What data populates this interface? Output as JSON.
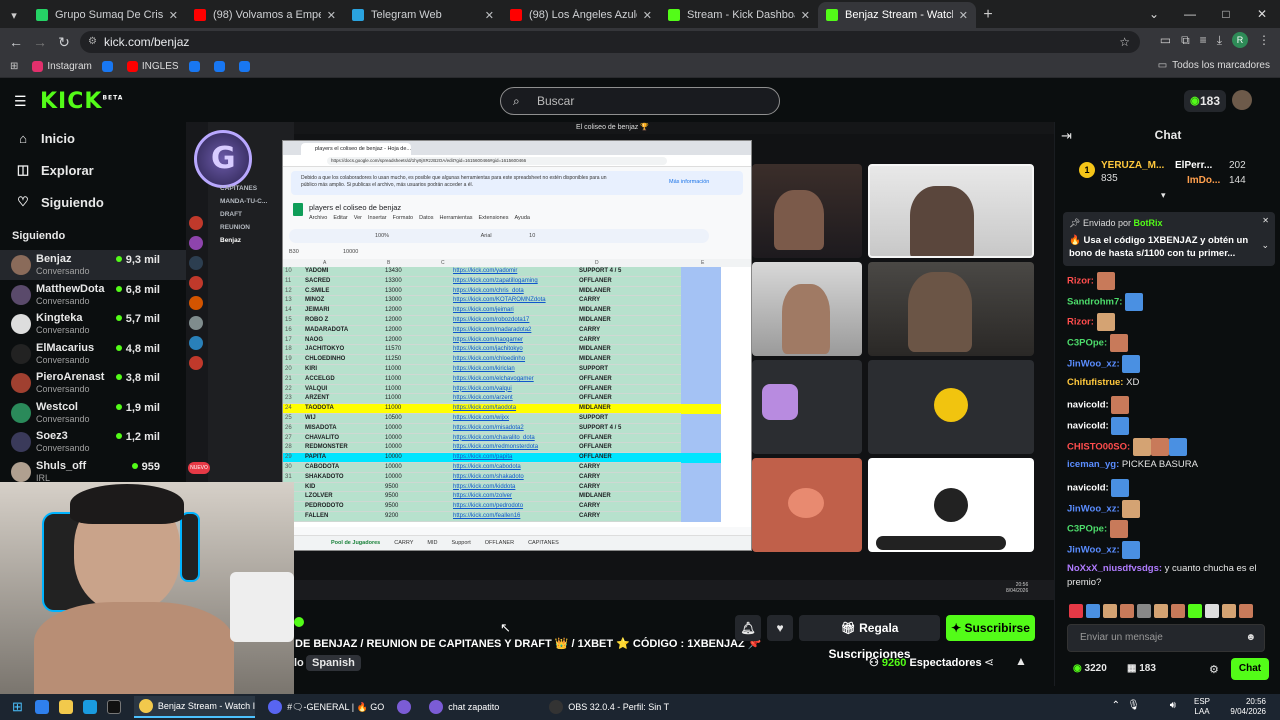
{
  "browser": {
    "tabs": [
      {
        "label": "Grupo Sumaq De Crispin Alegría",
        "color": "#25d366",
        "active": false
      },
      {
        "label": "(98) Volvamos a Empezar - YouTube",
        "color": "#ff0000",
        "active": false
      },
      {
        "label": "Telegram Web",
        "color": "#2aa3df",
        "active": false
      },
      {
        "label": "(98) Los Ángeles Azules - Nunca...",
        "color": "#ff0000",
        "active": false
      },
      {
        "label": "Stream - Kick Dashboard",
        "color": "#53fc18",
        "active": false
      },
      {
        "label": "Benjaz Stream - Watch Live",
        "color": "#53fc18",
        "active": true
      }
    ],
    "url": "kick.com/benjaz",
    "bookmarks": [
      {
        "label": "Instagram",
        "color": "#e1306c"
      },
      {
        "label": "",
        "color": "#1877f2"
      },
      {
        "label": "INGLES",
        "color": "#ff0000"
      },
      {
        "label": "",
        "color": "#1877f2"
      },
      {
        "label": "",
        "color": "#1877f2"
      },
      {
        "label": "",
        "color": "#1877f2"
      }
    ],
    "all_bookmarks": "Todos los marcadores",
    "profile_initial": "R"
  },
  "kick": {
    "logo": "KICK",
    "logo_sup": "BETA",
    "search_placeholder": "Buscar",
    "points": "183",
    "nav": [
      {
        "label": "Inicio",
        "icon": "home-icon",
        "glyph": "⌂"
      },
      {
        "label": "Explorar",
        "icon": "compass-icon",
        "glyph": "◫"
      },
      {
        "label": "Siguiendo",
        "icon": "heart-icon",
        "glyph": "♡"
      }
    ],
    "following_header": "Siguiendo",
    "following": [
      {
        "name": "Benjaz",
        "category": "Conversando",
        "viewers": "9,3 mil",
        "active": true,
        "avatar": "#8a6b5a"
      },
      {
        "name": "MatthewDota",
        "category": "Conversando",
        "viewers": "6,8 mil",
        "active": false,
        "avatar": "#5a4a6b"
      },
      {
        "name": "Kingteka",
        "category": "Conversando",
        "viewers": "5,7 mil",
        "active": false,
        "avatar": "#dddddd"
      },
      {
        "name": "ElMacarius",
        "category": "Conversando",
        "viewers": "4,8 mil",
        "active": false,
        "avatar": "#222222"
      },
      {
        "name": "PieroArenast",
        "category": "Conversando",
        "viewers": "3,8 mil",
        "active": false,
        "avatar": "#a04030"
      },
      {
        "name": "Westcol",
        "category": "Conversando",
        "viewers": "1,9 mil",
        "active": false,
        "avatar": "#2a8a5a"
      },
      {
        "name": "Soez3",
        "category": "Conversando",
        "viewers": "1,2 mil",
        "active": false,
        "avatar": "#3a3a5a"
      },
      {
        "name": "Shuls_off",
        "category": "IRL",
        "viewers": "959",
        "active": false,
        "avatar": "#b0a090"
      }
    ]
  },
  "stream": {
    "inner_title": "El coliseo de benjaz 🏆",
    "sheet": {
      "tab_title": "players el coliseo de benjaz - Hoja de...",
      "url": "https://docs.google.com/spreadsheets/d/1hy9jXRzzB2OA/edit?gid=1615600466#gid=1615600466",
      "banner": "Debido a que los colaboradores lo usan mucho, es posible que algunas herramientas para este spreadsheet no estén disponibles para un público más amplio. Si publicas el archivo, más usuarios podrán acceder a él.",
      "banner_link": "Más información",
      "doc_title": "players el coliseo de benjaz",
      "menus": [
        "Archivo",
        "Editar",
        "Ver",
        "Insertar",
        "Formato",
        "Datos",
        "Herramientas",
        "Extensiones",
        "Ayuda"
      ],
      "cell_ref": "B30",
      "formula": "10000",
      "zoom": "100%",
      "font": "Arial",
      "font_size": "10",
      "columns": [
        "A",
        "B",
        "C",
        "D",
        "E"
      ],
      "rows": [
        {
          "n": "10",
          "name": "YADOMI",
          "mmr": "13430",
          "link": "https://kick.com/yadomir",
          "role": "SUPPORT 4 / 5",
          "hl": ""
        },
        {
          "n": "11",
          "name": "SACRED",
          "mmr": "13300",
          "link": "https://kick.com/zapatillogaming",
          "role": "OFFLANER",
          "hl": ""
        },
        {
          "n": "12",
          "name": "C.SMILE",
          "mmr": "13000",
          "link": "https://kick.com/chris_dota",
          "role": "MIDLANER",
          "hl": ""
        },
        {
          "n": "13",
          "name": "MINOZ",
          "mmr": "13000",
          "link": "https://kick.com/KOTAROMNZdota",
          "role": "CARRY",
          "hl": ""
        },
        {
          "n": "14",
          "name": "JEIMARI",
          "mmr": "12000",
          "link": "https://kick.com/jeimari",
          "role": "MIDLANER",
          "hl": ""
        },
        {
          "n": "15",
          "name": "ROBO Z",
          "mmr": "12000",
          "link": "https://kick.com/robozdota17",
          "role": "MIDLANER",
          "hl": ""
        },
        {
          "n": "16",
          "name": "MADARADOTA",
          "mmr": "12000",
          "link": "https://kick.com/madaradota2",
          "role": "CARRY",
          "hl": ""
        },
        {
          "n": "17",
          "name": "NAOG",
          "mmr": "12000",
          "link": "https://kick.com/naogamer",
          "role": "CARRY",
          "hl": ""
        },
        {
          "n": "18",
          "name": "JACHITOKYO",
          "mmr": "11570",
          "link": "https://kick.com/jachitokyo",
          "role": "MIDLANER",
          "hl": ""
        },
        {
          "n": "19",
          "name": "CHLOEDINHO",
          "mmr": "11250",
          "link": "https://kick.com/chloedinho",
          "role": "MIDLANER",
          "hl": ""
        },
        {
          "n": "20",
          "name": "KIRI",
          "mmr": "11000",
          "link": "https://kick.com/kiriclan",
          "role": "SUPPORT",
          "hl": ""
        },
        {
          "n": "21",
          "name": "ACCELGD",
          "mmr": "11000",
          "link": "https://kick.com/elchavogamer",
          "role": "OFFLANER",
          "hl": ""
        },
        {
          "n": "22",
          "name": "VALQUI",
          "mmr": "11000",
          "link": "https://kick.com/valqui",
          "role": "OFFLANER",
          "hl": ""
        },
        {
          "n": "23",
          "name": "ARZENT",
          "mmr": "11000",
          "link": "https://kick.com/arzent",
          "role": "OFFLANER",
          "hl": ""
        },
        {
          "n": "24",
          "name": "TAODOTA",
          "mmr": "11000",
          "link": "https://kick.com/taodota",
          "role": "MIDLANER",
          "hl": "#ffff00"
        },
        {
          "n": "25",
          "name": "WIJ",
          "mmr": "10500",
          "link": "https://kick.com/wijxx",
          "role": "SUPPORT",
          "hl": ""
        },
        {
          "n": "26",
          "name": "MISADOTA",
          "mmr": "10000",
          "link": "https://kick.com/misadota2",
          "role": "SUPPORT 4 / 5",
          "hl": ""
        },
        {
          "n": "27",
          "name": "CHAVALITO",
          "mmr": "10000",
          "link": "https://kick.com/chavalito_dota",
          "role": "OFFLANER",
          "hl": ""
        },
        {
          "n": "28",
          "name": "REDMONSTER",
          "mmr": "10000",
          "link": "https://kick.com/redmonsterdota",
          "role": "OFFLANER",
          "hl": ""
        },
        {
          "n": "29",
          "name": "PAPITA",
          "mmr": "10000",
          "link": "https://kick.com/papita",
          "role": "OFFLANER",
          "hl": "#00e5ff"
        },
        {
          "n": "30",
          "name": "CABODOTA",
          "mmr": "10000",
          "link": "https://kick.com/cabodota",
          "role": "CARRY",
          "hl": ""
        },
        {
          "n": "31",
          "name": "SHAKADOTO",
          "mmr": "10000",
          "link": "https://kick.com/shakadoto",
          "role": "CARRY",
          "hl": ""
        },
        {
          "n": "32",
          "name": "KID",
          "mmr": "9500",
          "link": "https://kick.com/kiddota",
          "role": "CARRY",
          "hl": ""
        },
        {
          "n": "33",
          "name": "LZOLVER",
          "mmr": "9500",
          "link": "https://kick.com/zolver",
          "role": "MIDLANER",
          "hl": ""
        },
        {
          "n": "34",
          "name": "PEDRODOTO",
          "mmr": "9500",
          "link": "https://kick.com/pedrodoto",
          "role": "CARRY",
          "hl": ""
        },
        {
          "n": "35",
          "name": "FALLEN",
          "mmr": "9200",
          "link": "https://kick.com/feallen16",
          "role": "CARRY",
          "hl": ""
        }
      ],
      "sheet_tabs": [
        "Pool de Jugadores",
        "CARRY",
        "MID",
        "Support",
        "OFFLANER",
        "CAPITANES"
      ]
    },
    "discord_channels": [
      "CAPITANES",
      "MANDA-TU-C...",
      "DRAFT",
      "REUNION",
      "Benjaz"
    ],
    "clock": "20:56",
    "date": "8/04/2026",
    "title": "DE BENJAZ / REUNION DE CAPITANES Y DRAFT 👑 / 1XBET ⭐ CÓDIGO : 1XBENJAZ 📌",
    "title_prefix": "lo",
    "language": "Spanish",
    "gift_button": "Regala Suscripciones",
    "subscribe_button": "Suscribirse",
    "viewers": "9260",
    "viewers_label": "Espectadores"
  },
  "chat": {
    "title": "Chat",
    "leaders": [
      {
        "name": "YERUZA_M...",
        "value": "835",
        "rank": "1"
      },
      {
        "name": "ElPerr...",
        "value": "202"
      },
      {
        "name": "ImDo...",
        "value": "144"
      }
    ],
    "pinned_by_label": "Enviado por",
    "pinned_by": "BotRix",
    "pinned_text": "🔥 Usa el código 1XBENJAZ y obtén un bono de hasta s/1100 con tu primer...",
    "messages": [
      {
        "user": "Rizor:",
        "text": "",
        "color": "#ff4d4d",
        "emotes": 1
      },
      {
        "user": "Sandrohm7:",
        "text": "",
        "color": "#4ddc6b",
        "emotes": 1
      },
      {
        "user": "Rizor:",
        "text": "",
        "color": "#ff4d4d",
        "emotes": 1
      },
      {
        "user": "C3POpe:",
        "text": "",
        "color": "#4ddc6b",
        "emotes": 1
      },
      {
        "user": "JinWoo_xz:",
        "text": "",
        "color": "#5a8dff",
        "emotes": 1
      },
      {
        "user": "Chifufistrue:",
        "text": "XD",
        "color": "#ffc83d",
        "emotes": 0
      },
      {
        "user": "navicold:",
        "text": "",
        "color": "#ffffff",
        "emotes": 1
      },
      {
        "user": "navicold:",
        "text": "",
        "color": "#ffffff",
        "emotes": 1
      },
      {
        "user": "CHISTO00SO:",
        "text": "",
        "color": "#ff4d4d",
        "emotes": 3
      },
      {
        "user": "iceman_yg:",
        "text": "PICKEA BASURA",
        "color": "#5a8dff",
        "emotes": 0
      },
      {
        "user": "navicold:",
        "text": "",
        "color": "#ffffff",
        "emotes": 1
      },
      {
        "user": "JinWoo_xz:",
        "text": "",
        "color": "#5a8dff",
        "emotes": 1
      },
      {
        "user": "C3POpe:",
        "text": "",
        "color": "#4ddc6b",
        "emotes": 1
      },
      {
        "user": "JinWoo_xz:",
        "text": "",
        "color": "#5a8dff",
        "emotes": 1
      },
      {
        "user": "NoXxX_niusdfvsdgs:",
        "text": "y cuanto chucha es el premio?",
        "color": "#b07cff",
        "emotes": 0
      }
    ],
    "input_placeholder": "Enviar un mensaje",
    "user_points": "3220",
    "user_badge_count": "183",
    "send_label": "Chat"
  },
  "taskbar": {
    "items": [
      {
        "label": "Benjaz Stream - Watch I",
        "color": "#f2c94c"
      },
      {
        "label": "#🗨-GENERAL | 🔥 GO",
        "color": "#5865f2"
      },
      {
        "label": "",
        "color": "#7b5cd6"
      },
      {
        "label": "chat zapatito",
        "color": "#7b5cd6"
      },
      {
        "label": "OBS 32.0.4 - Perfil: Sin T",
        "color": "#333333"
      }
    ],
    "lang": "ESP",
    "lang2": "LAA",
    "time": "20:56",
    "date": "9/04/2026"
  }
}
